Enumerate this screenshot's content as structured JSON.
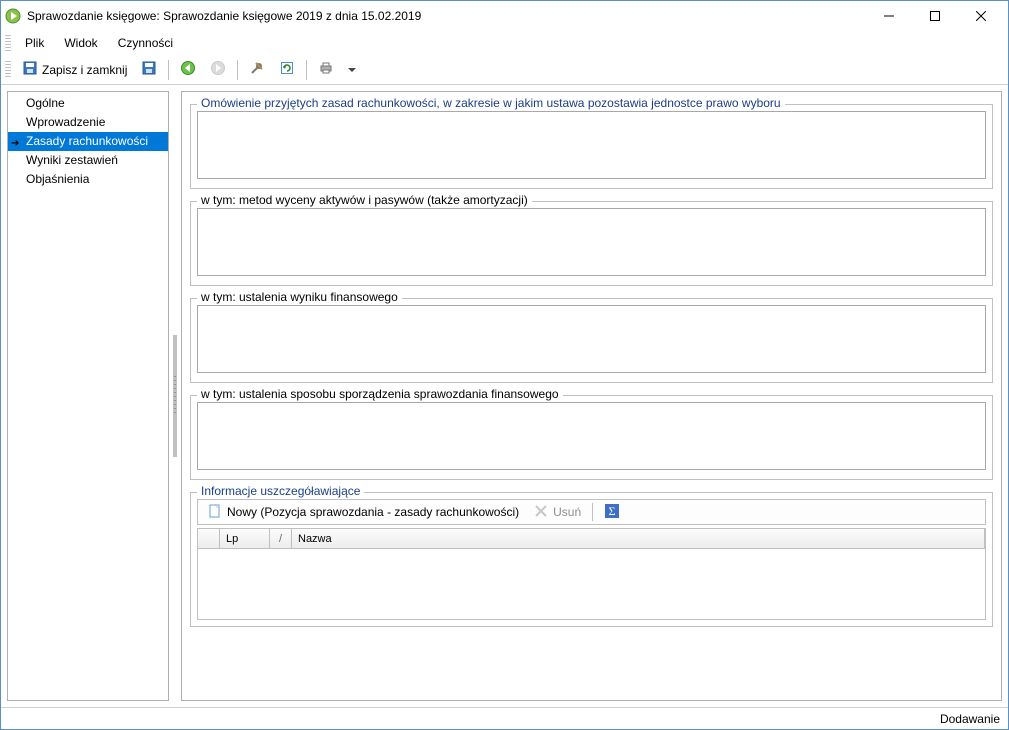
{
  "window": {
    "title": "Sprawozdanie księgowe: Sprawozdanie księgowe 2019 z dnia 15.02.2019"
  },
  "menu": {
    "items": [
      "Plik",
      "Widok",
      "Czynności"
    ]
  },
  "toolbar": {
    "save_close": "Zapisz i zamknij"
  },
  "sidebar": {
    "items": [
      {
        "label": "Ogólne",
        "selected": false
      },
      {
        "label": "Wprowadzenie",
        "selected": false
      },
      {
        "label": "Zasady rachunkowości",
        "selected": true
      },
      {
        "label": "Wyniki zestawień",
        "selected": false
      },
      {
        "label": "Objaśnienia",
        "selected": false
      }
    ]
  },
  "form": {
    "group1_legend": "Omówienie przyjętych zasad rachunkowości, w zakresie w jakim ustawa pozostawia jednostce prawo wyboru",
    "group2_legend": "w tym: metod wyceny aktywów i pasywów (także amortyzacji)",
    "group3_legend": "w tym: ustalenia wyniku finansowego",
    "group4_legend": "w tym: ustalenia sposobu sporządzenia sprawozdania finansowego",
    "group5_legend": "Informacje uszczegóławiające",
    "field1": "",
    "field2": "",
    "field3": "",
    "field4": ""
  },
  "detail_toolbar": {
    "new_label": "Nowy (Pozycja sprawozdania - zasady rachunkowości)",
    "delete_label": "Usuń"
  },
  "grid": {
    "col_lp": "Lp",
    "col_sort": "/",
    "col_nazwa": "Nazwa"
  },
  "status": {
    "text": "Dodawanie"
  }
}
